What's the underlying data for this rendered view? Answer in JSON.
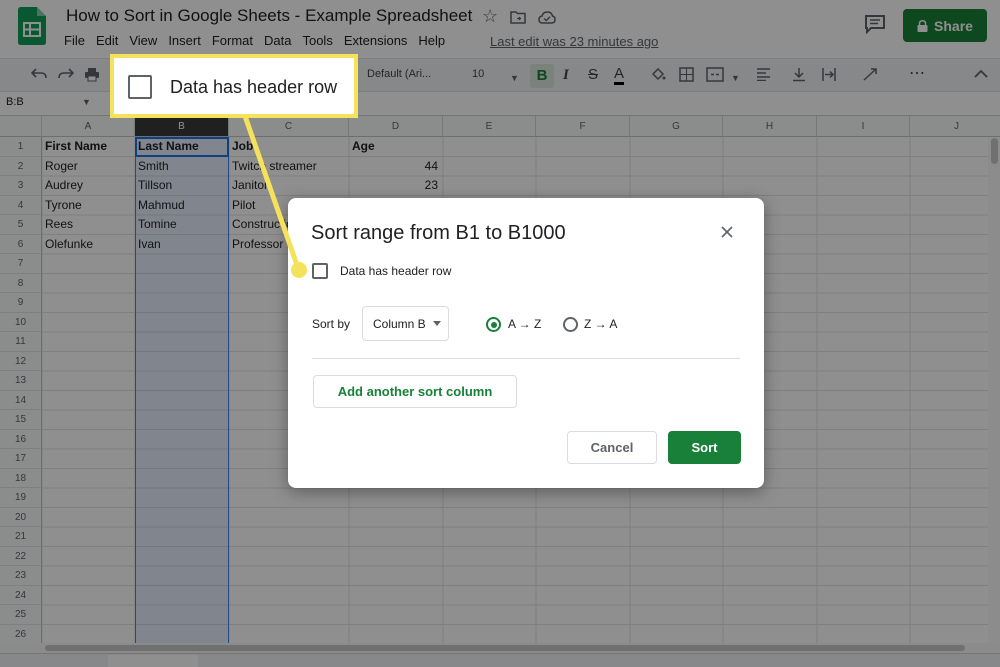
{
  "header": {
    "title": "How to Sort in Google Sheets - Example Spreadsheet",
    "menu": [
      "File",
      "Edit",
      "View",
      "Insert",
      "Format",
      "Data",
      "Tools",
      "Extensions",
      "Help"
    ],
    "last_edit": "Last edit was 23 minutes ago",
    "share_label": "Share"
  },
  "toolbar": {
    "font_name": "Default (Ari...",
    "font_size": "10",
    "bold_label": "B",
    "italic_label": "I",
    "strike_label": "S",
    "text_color_label": "A",
    "more_label": "⋯"
  },
  "formula_bar": {
    "name_box": "B:B"
  },
  "grid": {
    "columns": [
      "A",
      "B",
      "C",
      "D",
      "E",
      "F",
      "G",
      "H",
      "I",
      "J"
    ],
    "rows": [
      "1",
      "2",
      "3",
      "4",
      "5",
      "6",
      "7",
      "8",
      "9",
      "10",
      "11",
      "12",
      "13",
      "14",
      "15",
      "16",
      "17",
      "18",
      "19",
      "20",
      "21",
      "22",
      "23",
      "24",
      "25",
      "26"
    ],
    "cells": [
      [
        "First Name",
        "Last Name",
        "Job",
        "Age"
      ],
      [
        "Roger",
        "Smith",
        "Twitch streamer",
        "44"
      ],
      [
        "Audrey",
        "Tillson",
        "Janitor",
        "23"
      ],
      [
        "Tyrone",
        "Mahmud",
        "Pilot",
        ""
      ],
      [
        "Rees",
        "Tomine",
        "Construction",
        ""
      ],
      [
        "Olefunke",
        "Ivan",
        "Professor",
        ""
      ]
    ]
  },
  "dialog": {
    "title": "Sort range from B1 to B1000",
    "header_checkbox_label": "Data has header row",
    "sort_by_label": "Sort by",
    "column_value": "Column B",
    "az_label": "A → Z",
    "za_label": "Z → A",
    "add_sort_label": "Add another sort column",
    "cancel_label": "Cancel",
    "sort_label": "Sort"
  },
  "callout": {
    "label": "Data has header row"
  },
  "colors": {
    "accent": "#188038",
    "callout": "#f4e25c",
    "selection": "#1a73e8"
  }
}
